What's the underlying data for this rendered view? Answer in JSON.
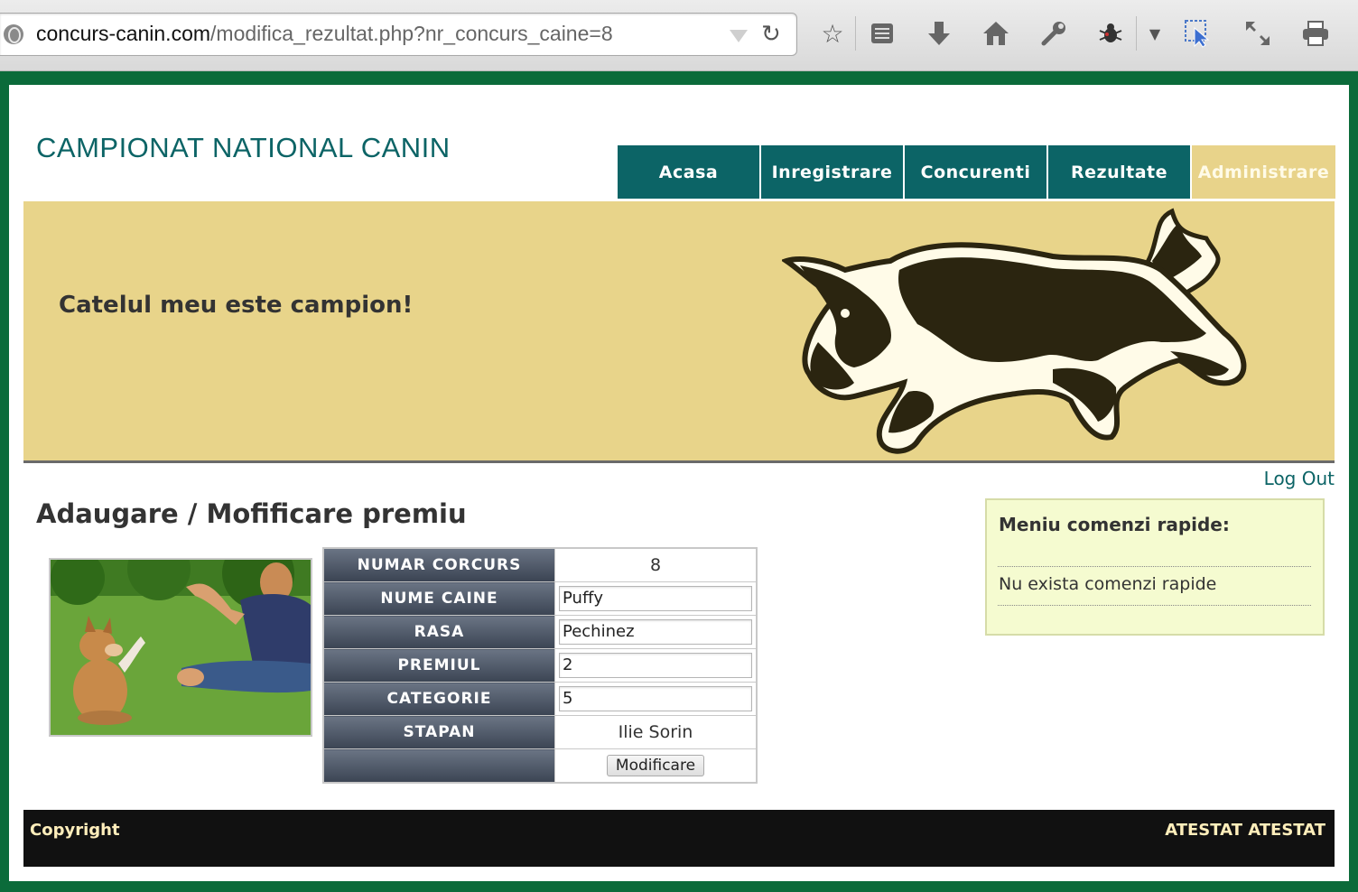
{
  "browser": {
    "url_host": "concurs-canin.com",
    "url_path": "/modifica_rezultat.php?nr_concurs_caine=8",
    "toolbar_icons": [
      "star-icon",
      "reading-list-icon",
      "download-icon",
      "home-icon",
      "wrench-icon",
      "firebug-icon",
      "dropdown-icon",
      "cursor-icon",
      "fullscreen-icon",
      "print-icon"
    ]
  },
  "site": {
    "title": "CAMPIONAT NATIONAL CANIN",
    "nav": [
      "Acasa",
      "Inregistrare",
      "Concurenti",
      "Rezultate",
      "Administrare"
    ],
    "active_nav": "Administrare",
    "slogan": "Catelul meu este campion!",
    "logout": "Log Out"
  },
  "main": {
    "heading": "Adaugare / Mofificare premiu",
    "form": {
      "numar_label": "NUMAR CORCURS",
      "numar_value": "8",
      "nume_label": "NUME CAINE",
      "nume_value": "Puffy",
      "rasa_label": "RASA",
      "rasa_value": "Pechinez",
      "premiul_label": "PREMIUL",
      "premiul_value": "2",
      "categorie_label": "CATEGORIE",
      "categorie_value": "5",
      "stapan_label": "STAPAN",
      "stapan_value": "Ilie Sorin",
      "submit_label": "Modificare"
    }
  },
  "sidebar": {
    "title": "Meniu comenzi rapide:",
    "text": "Nu exista comenzi rapide"
  },
  "footer": {
    "left": "Copyright",
    "right": "ATESTAT ATESTAT"
  },
  "colors": {
    "nav_bg": "#0c6466",
    "banner_bg": "#e8d48a",
    "frame": "#0b6b3a",
    "footer_bg": "#111111"
  }
}
